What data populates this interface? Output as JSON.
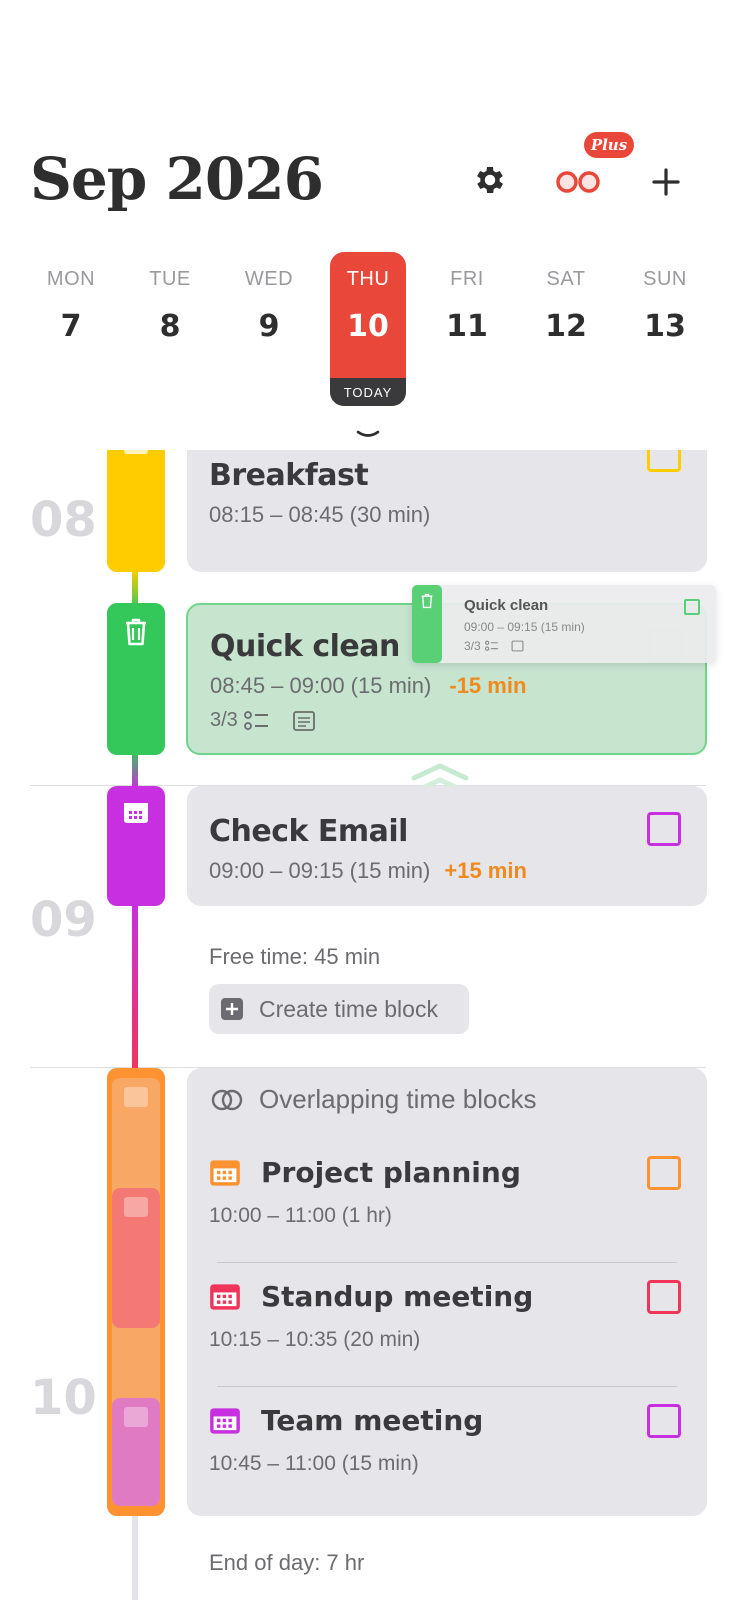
{
  "header": {
    "month_title": "Sep 2026",
    "plus_badge": "Plus"
  },
  "week": {
    "days": [
      {
        "name": "MON",
        "num": "7"
      },
      {
        "name": "TUE",
        "num": "8"
      },
      {
        "name": "WED",
        "num": "9"
      },
      {
        "name": "THU",
        "num": "10"
      },
      {
        "name": "FRI",
        "num": "11"
      },
      {
        "name": "SAT",
        "num": "12"
      },
      {
        "name": "SUN",
        "num": "13"
      }
    ],
    "today_label": "TODAY"
  },
  "hours": {
    "h08": "08",
    "h09": "09",
    "h10": "10"
  },
  "events": {
    "breakfast": {
      "title": "Breakfast",
      "time": "08:15 – 08:45 (30 min)"
    },
    "quick_clean": {
      "title": "Quick clean",
      "time": "08:45 – 09:00 (15 min)",
      "delta": "-15 min",
      "checklist": "3/3"
    },
    "drag_preview": {
      "title": "Quick clean",
      "time": "09:00 – 09:15 (15 min)",
      "checklist": "3/3"
    },
    "check_email": {
      "title": "Check Email",
      "time": "09:00 – 09:15 (15 min)",
      "delta": "+15 min"
    }
  },
  "free_time": {
    "text": "Free time: 45 min",
    "create_label": "Create time block"
  },
  "overlap": {
    "header": "Overlapping time blocks",
    "items": [
      {
        "title": "Project planning",
        "time": "10:00 – 11:00 (1 hr)"
      },
      {
        "title": "Standup meeting",
        "time": "10:15 – 10:35 (20 min)"
      },
      {
        "title": "Team meeting",
        "time": "10:45 – 11:00 (15 min)"
      }
    ]
  },
  "footer": {
    "end_of_day": "End of day: 7 hr"
  },
  "colors": {
    "accent": "#e8473a",
    "breakfast": "#ffcc00",
    "quick_clean": "#34c759",
    "check_email": "#c82fe0",
    "project_planning": "#ff9230",
    "standup": "#f0345a",
    "team_meeting": "#c82fe0",
    "delta": "#f08a1c"
  }
}
